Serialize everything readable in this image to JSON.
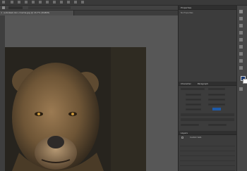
{
  "document": {
    "tab_title": "autodesk-lion-cinema.jpg @ 16.7% (RGB/8)"
  },
  "panels": {
    "properties": {
      "title": "Properties",
      "subtitle": "No Properties"
    },
    "character": {
      "title": "Character",
      "paragraph_tab": "Paragraph"
    },
    "layers": {
      "title": "Layers",
      "mode": "Custom Sets"
    }
  },
  "colors": {
    "foreground": "#1b3a70",
    "background": "#ffffff",
    "accent_swatch": "#1e5aa8"
  }
}
